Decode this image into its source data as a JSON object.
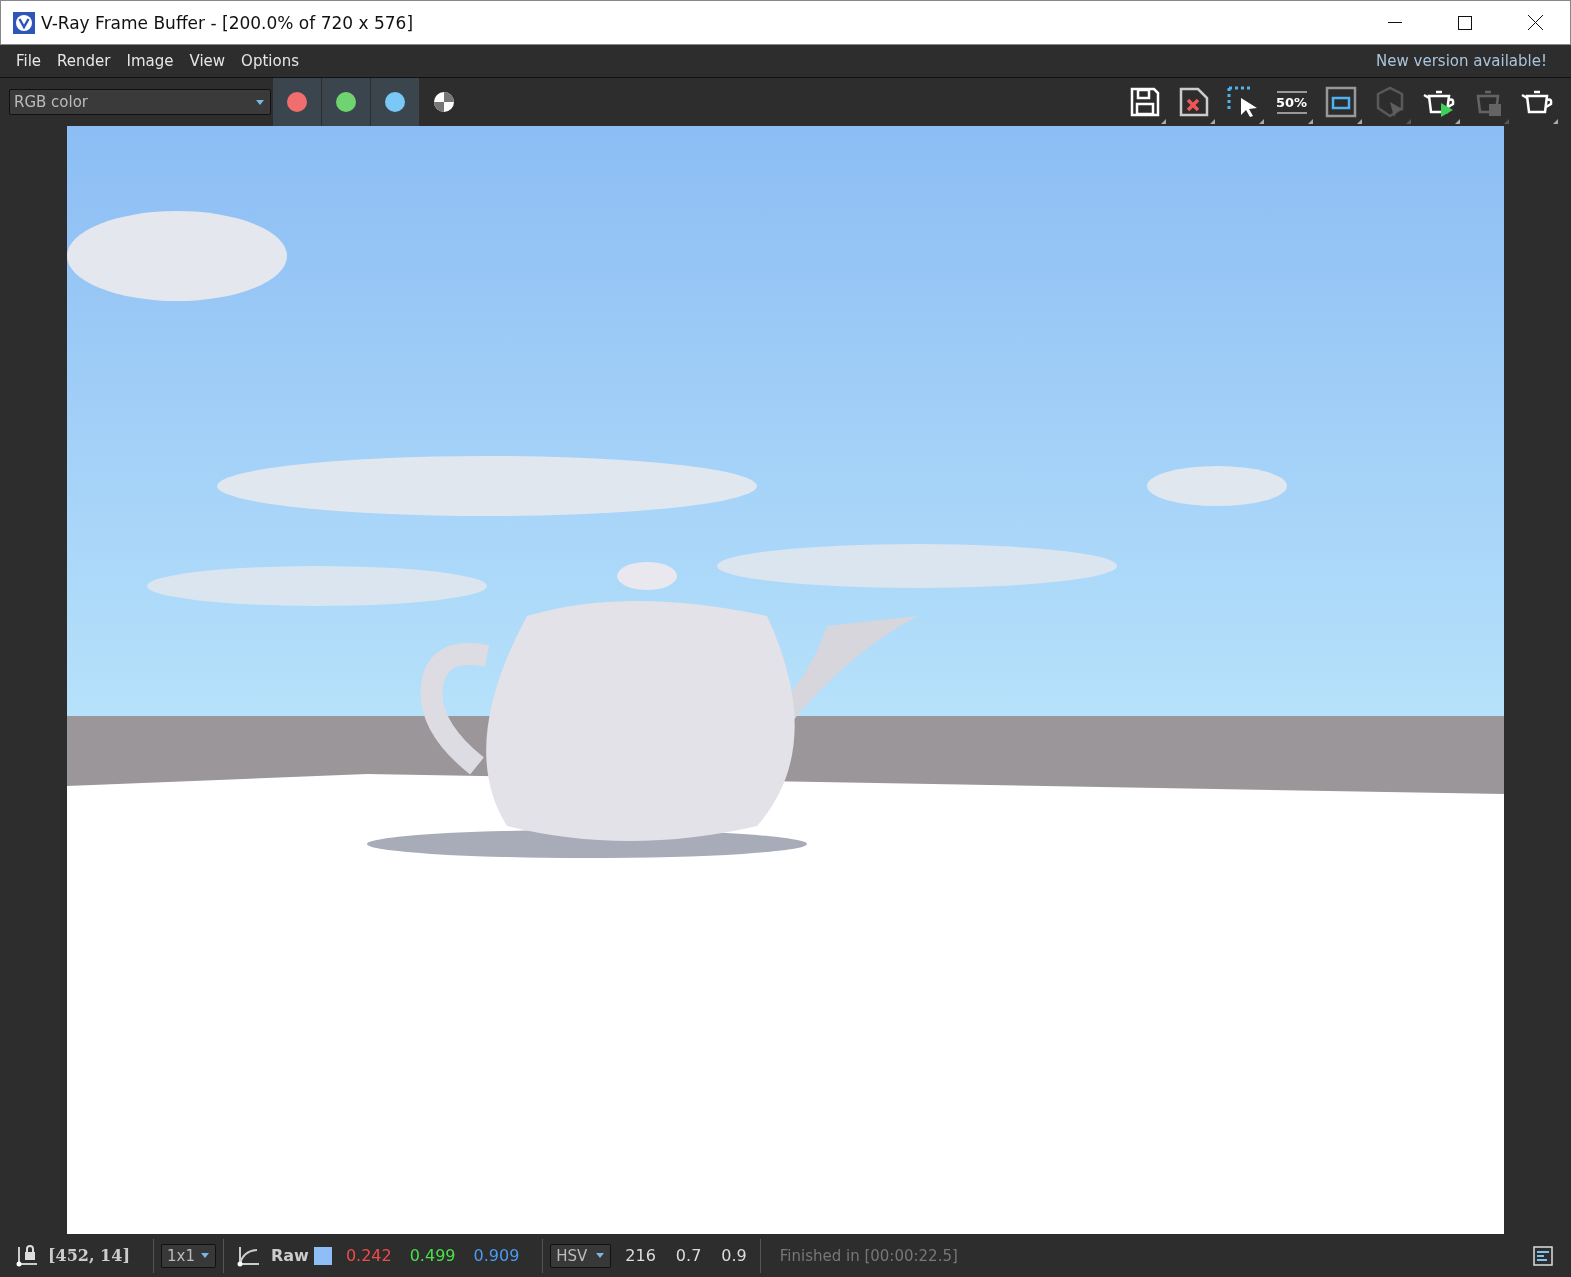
{
  "window": {
    "title": "V-Ray Frame Buffer - [200.0% of 720 x 576]"
  },
  "menu": [
    "File",
    "Render",
    "Image",
    "View",
    "Options"
  ],
  "notice": "New version available!",
  "channel_select": {
    "value": "RGB color"
  },
  "channels": [
    {
      "kind": "dot",
      "color": "#f26d6d",
      "on": true
    },
    {
      "kind": "dot",
      "color": "#6fd46f",
      "on": true
    },
    {
      "kind": "dot",
      "color": "#79c8f5",
      "on": true
    },
    {
      "kind": "alpha",
      "on": false
    }
  ],
  "tools": [
    {
      "kind": "save",
      "disabled": false
    },
    {
      "kind": "clear",
      "disabled": false
    },
    {
      "kind": "region",
      "disabled": false
    },
    {
      "kind": "zoom",
      "label": "50%",
      "disabled": false
    },
    {
      "kind": "frame",
      "disabled": false
    },
    {
      "kind": "interactive",
      "disabled": true
    },
    {
      "kind": "render",
      "disabled": false
    },
    {
      "kind": "stop",
      "disabled": true
    },
    {
      "kind": "teapot",
      "disabled": false
    }
  ],
  "status_bar": {
    "coords": "[452, 14]",
    "sample": "1x1",
    "mode": "Raw",
    "swatch": {
      "color": "#8fbdf5"
    },
    "rgb": [
      {
        "text": "0.242",
        "color": "#f04b4b"
      },
      {
        "text": "0.499",
        "color": "#4be04b"
      },
      {
        "text": "0.909",
        "color": "#4b9bf0"
      }
    ],
    "space": "HSV",
    "hsv": [
      "216",
      "0.7",
      "0.9"
    ],
    "message": "Finished in [00:00:22.5]"
  }
}
